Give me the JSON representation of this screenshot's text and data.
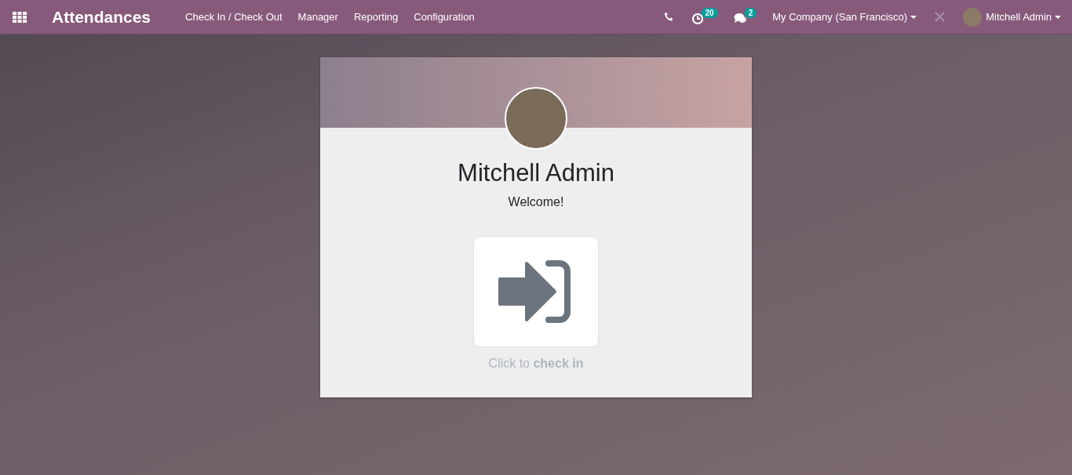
{
  "navbar": {
    "app_title": "Attendances",
    "menu": [
      {
        "label": "Check In / Check Out"
      },
      {
        "label": "Manager"
      },
      {
        "label": "Reporting"
      },
      {
        "label": "Configuration"
      }
    ],
    "systray": {
      "activity_count": "20",
      "message_count": "2",
      "company": "My Company (San Francisco)",
      "user": "Mitchell Admin"
    }
  },
  "card": {
    "employee_name": "Mitchell Admin",
    "greeting": "Welcome!",
    "action_hint": "Click to **check in**"
  }
}
